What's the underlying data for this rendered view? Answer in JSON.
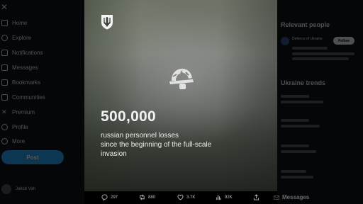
{
  "sidebar": {
    "items": [
      {
        "label": "Home",
        "icon": "home-icon"
      },
      {
        "label": "Explore",
        "icon": "search-icon"
      },
      {
        "label": "Notifications",
        "icon": "bell-icon"
      },
      {
        "label": "Messages",
        "icon": "mail-icon"
      },
      {
        "label": "Bookmarks",
        "icon": "bookmark-icon"
      },
      {
        "label": "Communities",
        "icon": "people-icon"
      },
      {
        "label": "Premium",
        "icon": "x-icon"
      },
      {
        "label": "Profile",
        "icon": "person-icon"
      },
      {
        "label": "More",
        "icon": "more-icon"
      }
    ],
    "post_label": "Post",
    "account_name": "Jakob Vah"
  },
  "right_column": {
    "relevant_heading": "Relevant people",
    "relevant_name": "Defence of Ukraine",
    "follow_label": "Follow",
    "trends_heading": "Ukraine trends"
  },
  "media": {
    "big_number": "500,000",
    "caption_lines": [
      "russian personnel losses",
      "since the beginning of the full-scale",
      "invasion"
    ]
  },
  "actions": {
    "replies": "297",
    "reposts": "880",
    "likes": "3.7K",
    "views": "92K"
  },
  "drawer": {
    "messages_label": "Messages"
  },
  "colors": {
    "accent": "#1d9bf0",
    "media_text": "#f2f2f2"
  }
}
